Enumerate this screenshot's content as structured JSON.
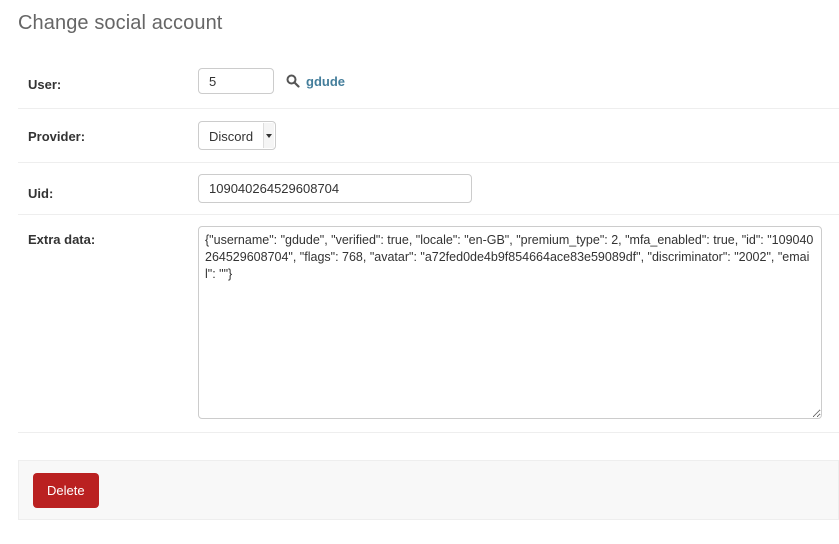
{
  "page_title": "Change social account",
  "fields": {
    "user": {
      "label": "User:",
      "value": "5",
      "lookup_icon": "search-icon",
      "lookup_text": "gdude"
    },
    "provider": {
      "label": "Provider:",
      "selected": "Discord"
    },
    "uid": {
      "label": "Uid:",
      "value": "109040264529608704"
    },
    "extra_data": {
      "label": "Extra data:",
      "value": "{\"username\": \"gdude\", \"verified\": true, \"locale\": \"en-GB\", \"premium_type\": 2, \"mfa_enabled\": true, \"id\": \"109040264529608704\", \"flags\": 768, \"avatar\": \"a72fed0de4b9f854664ace83e59089df\", \"discriminator\": \"2002\", \"email\": \"\"}"
    }
  },
  "actions": {
    "delete_label": "Delete"
  },
  "colors": {
    "link": "#447e9b",
    "delete": "#ba2121"
  }
}
